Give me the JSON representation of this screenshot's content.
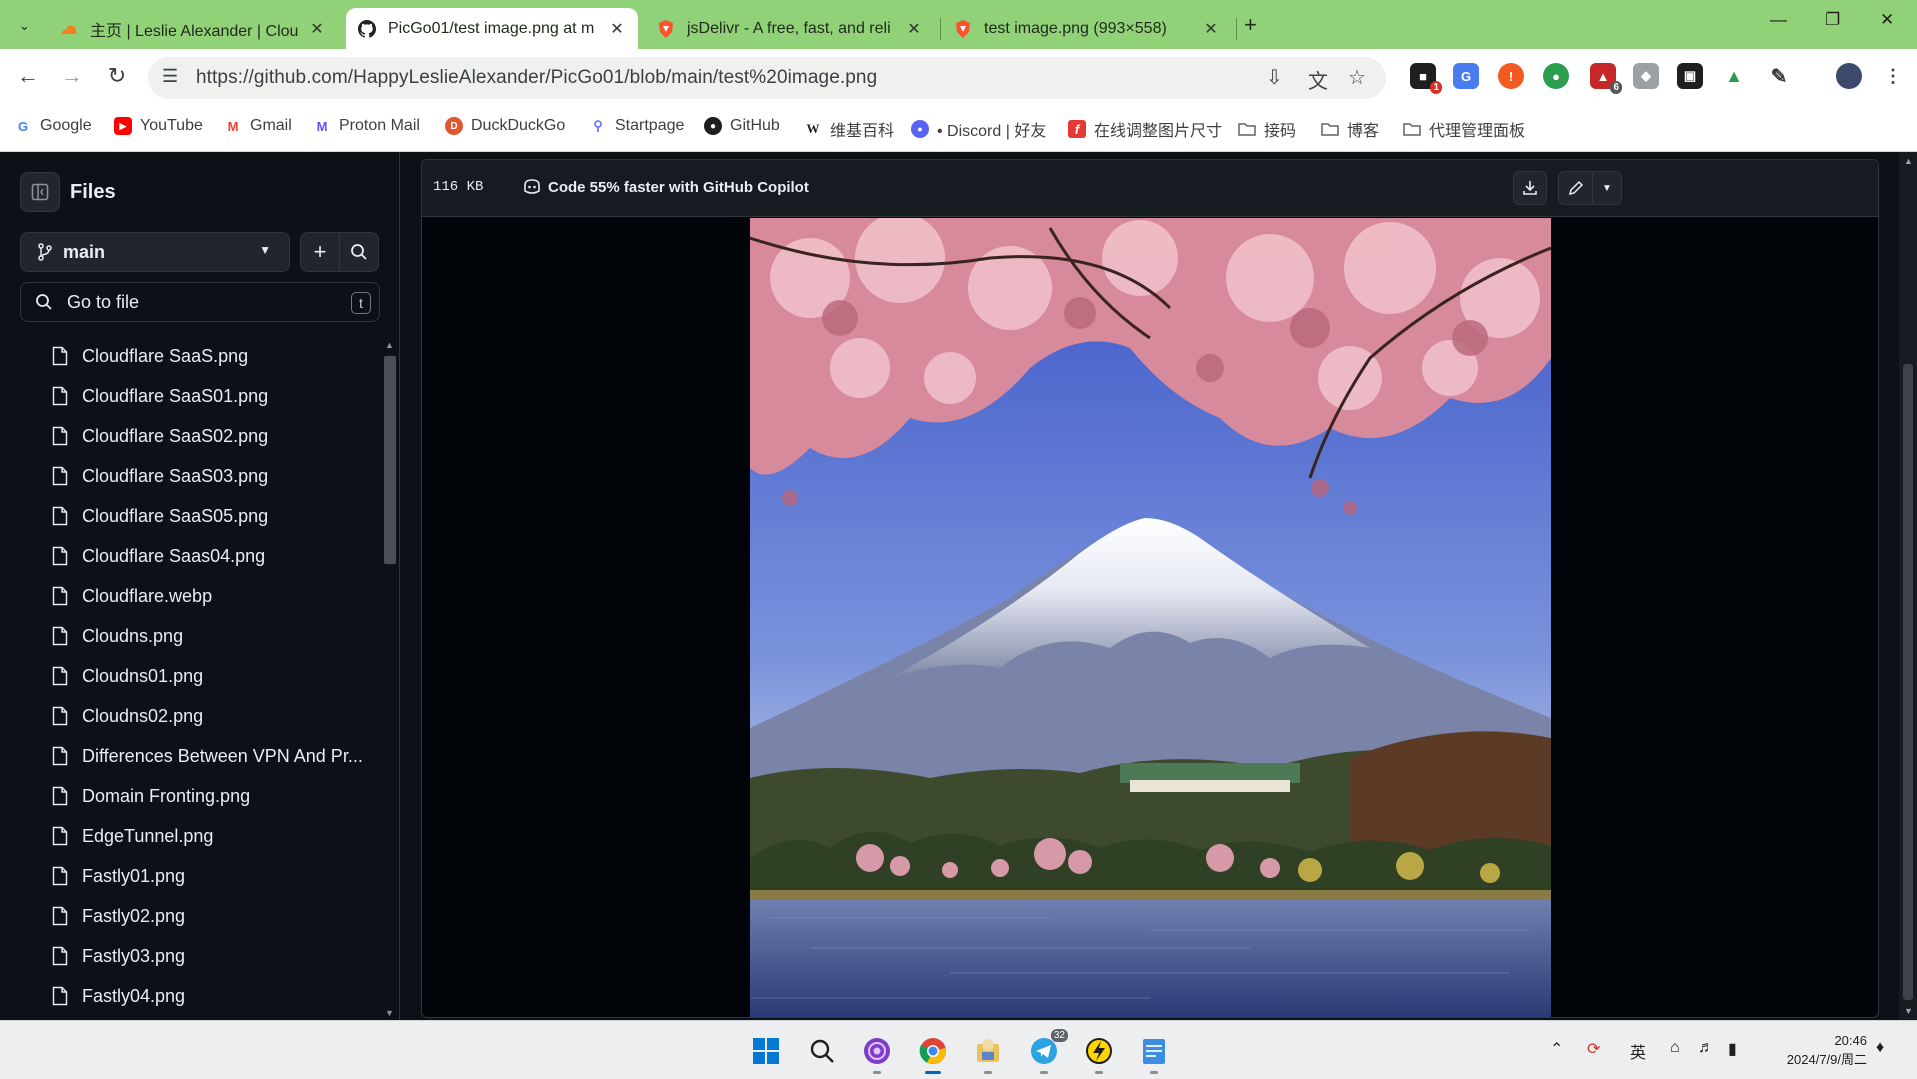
{
  "browser": {
    "tabs": [
      {
        "title": "主页 | Leslie Alexander | Clou",
        "icon": "cloudflare-icon",
        "active": false
      },
      {
        "title": "PicGo01/test image.png at m",
        "icon": "github-icon",
        "active": true
      },
      {
        "title": "jsDelivr - A free, fast, and reli",
        "icon": "brave-shield-icon",
        "active": false
      },
      {
        "title": "test image.png (993×558)",
        "icon": "brave-shield-icon",
        "active": false
      }
    ],
    "url": "https://github.com/HappyLeslieAlexander/PicGo01/blob/main/test%20image.png",
    "extension_badges": {
      "first": "1",
      "second": "6"
    },
    "bookmarks": [
      {
        "label": "Google",
        "icon": "google-icon"
      },
      {
        "label": "YouTube",
        "icon": "youtube-icon"
      },
      {
        "label": "Gmail",
        "icon": "gmail-icon"
      },
      {
        "label": "Proton Mail",
        "icon": "proton-mail-icon"
      },
      {
        "label": "DuckDuckGo",
        "icon": "duckduckgo-icon"
      },
      {
        "label": "Startpage",
        "icon": "startpage-icon"
      },
      {
        "label": "GitHub",
        "icon": "github-icon"
      },
      {
        "label": "维基百科",
        "icon": "wikipedia-icon"
      },
      {
        "label": "• Discord | 好友",
        "icon": "discord-icon"
      },
      {
        "label": "在线调整图片尺寸",
        "icon": "resize-icon"
      },
      {
        "label": "接码",
        "icon": "folder-icon"
      },
      {
        "label": "博客",
        "icon": "folder-icon"
      },
      {
        "label": "代理管理面板",
        "icon": "folder-icon"
      }
    ]
  },
  "sidebar": {
    "title": "Files",
    "branch": "main",
    "go_to_file": "Go to file",
    "shortcut_key": "t",
    "files": [
      "Cloudflare SaaS.png",
      "Cloudflare SaaS01.png",
      "Cloudflare SaaS02.png",
      "Cloudflare SaaS03.png",
      "Cloudflare SaaS05.png",
      "Cloudflare Saas04.png",
      "Cloudflare.webp",
      "Cloudns.png",
      "Cloudns01.png",
      "Cloudns02.png",
      "Differences Between VPN And Pr...",
      "Domain Fronting.png",
      "EdgeTunnel.png",
      "Fastly01.png",
      "Fastly02.png",
      "Fastly03.png",
      "Fastly04.png"
    ]
  },
  "viewer": {
    "file_size": "116 KB",
    "copilot_promo": "Code 55% faster with GitHub Copilot",
    "image_alt": "Mount Fuji with cherry blossoms over a lake"
  },
  "taskbar": {
    "time": "20:46",
    "date": "2024/7/9/周二",
    "ime": "英",
    "telegram_badge": "32"
  },
  "colors": {
    "tabstrip": "#91d178",
    "github_bg": "#0d1117",
    "border": "#30363d"
  }
}
